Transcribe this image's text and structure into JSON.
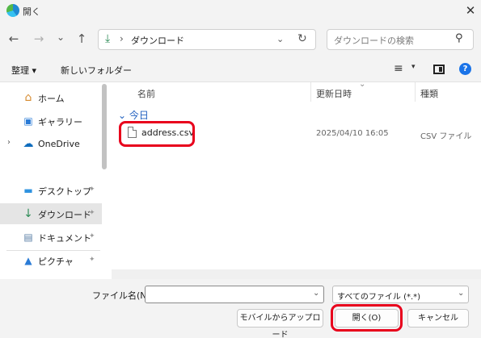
{
  "window": {
    "title": "開く",
    "close_glyph": "✕"
  },
  "nav_buttons": {
    "back": "←",
    "forward": "→",
    "recent": "⌄",
    "up": "↑"
  },
  "address": {
    "separator": "›",
    "location": "ダウンロード",
    "dropdown": "⌄",
    "refresh": "↻"
  },
  "search": {
    "placeholder": "ダウンロードの検索",
    "icon": "search-icon"
  },
  "toolbar": {
    "organize_label": "整理 ▾",
    "new_folder_label": "新しいフォルダー",
    "view_glyph": "≡",
    "view_dd": "▾",
    "help_glyph": "?"
  },
  "sidebar": {
    "items": [
      {
        "label": "ホーム",
        "icon": "home-icon",
        "glyph": "⌂"
      },
      {
        "label": "ギャラリー",
        "icon": "gallery-icon",
        "glyph": "▣"
      },
      {
        "label": "OneDrive",
        "icon": "cloud-icon",
        "glyph": "☁",
        "expander": "›"
      },
      {
        "label": "デスクトップ",
        "icon": "desktop-icon",
        "glyph": "▬",
        "pin": "📌"
      },
      {
        "label": "ダウンロード",
        "icon": "download-icon",
        "glyph": "↓",
        "pin": "📌",
        "selected": true
      },
      {
        "label": "ドキュメント",
        "icon": "document-icon",
        "glyph": "▤",
        "pin": "📌"
      },
      {
        "label": "ピクチャ",
        "icon": "picture-icon",
        "glyph": "▲",
        "pin": "📌"
      }
    ]
  },
  "columns": {
    "name": "名前",
    "modified": "更新日時",
    "type": "種類",
    "sort_glyph": "⌄"
  },
  "group": {
    "label": "⌄ 今日"
  },
  "files": [
    {
      "name": "address.csv",
      "modified": "2025/04/10 16:05",
      "type": "CSV ファイル"
    }
  ],
  "footer": {
    "filename_label": "ファイル名(N):",
    "filename_value": "",
    "filename_dd": "⌄",
    "filetype_value": "すべてのファイル (*.*)",
    "filetype_dd": "⌄",
    "upload_label": "モバイルからアップロード",
    "open_label": "開く(O)",
    "cancel_label": "キャンセル"
  },
  "colors": {
    "highlight": "#e8001c",
    "accent": "#1a73e8",
    "group_header": "#1f5fbf"
  }
}
